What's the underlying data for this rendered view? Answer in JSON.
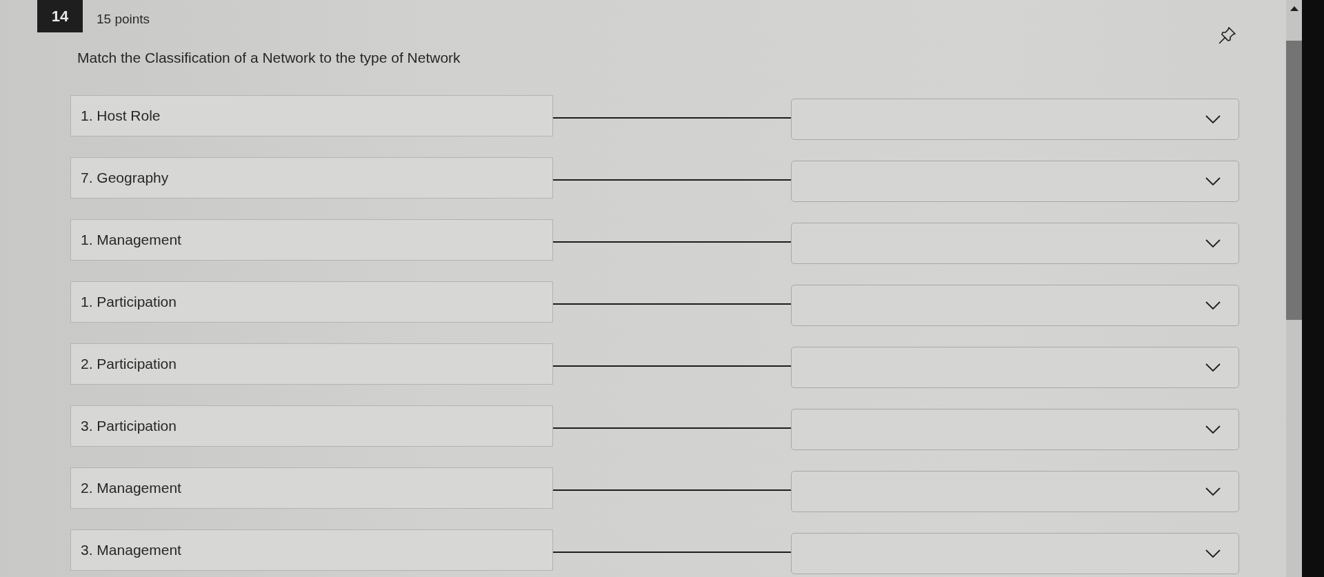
{
  "question": {
    "number": "14",
    "points": "15 points",
    "prompt": "Match the Classification of a Network to the type of Network"
  },
  "matches": [
    {
      "prompt": "1. Host Role"
    },
    {
      "prompt": "7. Geography"
    },
    {
      "prompt": "1. Management"
    },
    {
      "prompt": "1. Participation"
    },
    {
      "prompt": "2. Participation"
    },
    {
      "prompt": "3. Participation"
    },
    {
      "prompt": "2. Management"
    },
    {
      "prompt": "3. Management"
    }
  ]
}
